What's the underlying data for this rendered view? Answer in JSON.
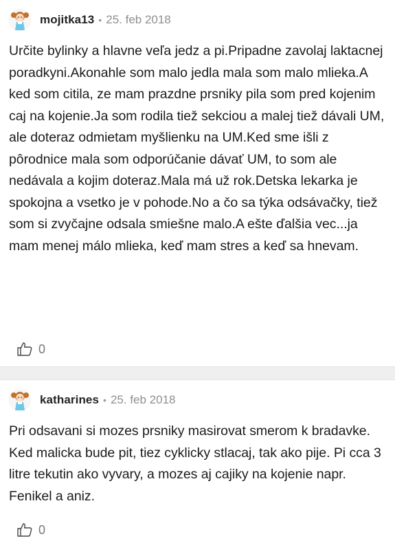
{
  "comments": [
    {
      "username": "mojitka13",
      "separator": "•",
      "date": "25. feb 2018",
      "avatar_icon": "doll-avatar-icon",
      "text": "Určite bylinky a hlavne veľa jedz a pi.Pripadne zavolaj laktacnej poradkyni.Akonahle som malo jedla mala som malo mlieka.A ked som citila, ze mam prazdne prsniky pila som pred kojenim caj na kojenie.Ja som rodila tiež sekciou a malej tiež dávali UM, ale doteraz odmietam myšlienku na UM.Ked sme išli z pôrodnice mala som odporúčanie dávať UM, to som ale nedávala a kojim doteraz.Mala má už rok.Detska lekarka je spokojna a vsetko je v pohode.No a čo sa týka odsávačky, tiež som si zvyčajne odsala smiešne malo.A ešte ďalšia vec...ja mam menej málo mlieka, keď mam stres a keď sa hnevam.",
      "like_icon": "thumbs-up-icon",
      "likes": "0"
    },
    {
      "username": "katharines",
      "separator": "•",
      "date": "25. feb 2018",
      "avatar_icon": "doll-avatar-icon",
      "text": "Pri odsavani si mozes prsniky masirovat smerom k bradavke. Ked malicka bude pit, tiez cyklicky stlacaj, tak ako pije. Pi cca 3 litre tekutin ako vyvary, a mozes aj cajiky na kojenie napr. Fenikel a aniz.",
      "like_icon": "thumbs-up-icon",
      "likes": "0"
    }
  ],
  "colors": {
    "divider": "#efefef",
    "username": "#222222",
    "date": "#8e8e8e",
    "avatar_hair": "#b5651d",
    "avatar_dress": "#6ec6e8"
  }
}
